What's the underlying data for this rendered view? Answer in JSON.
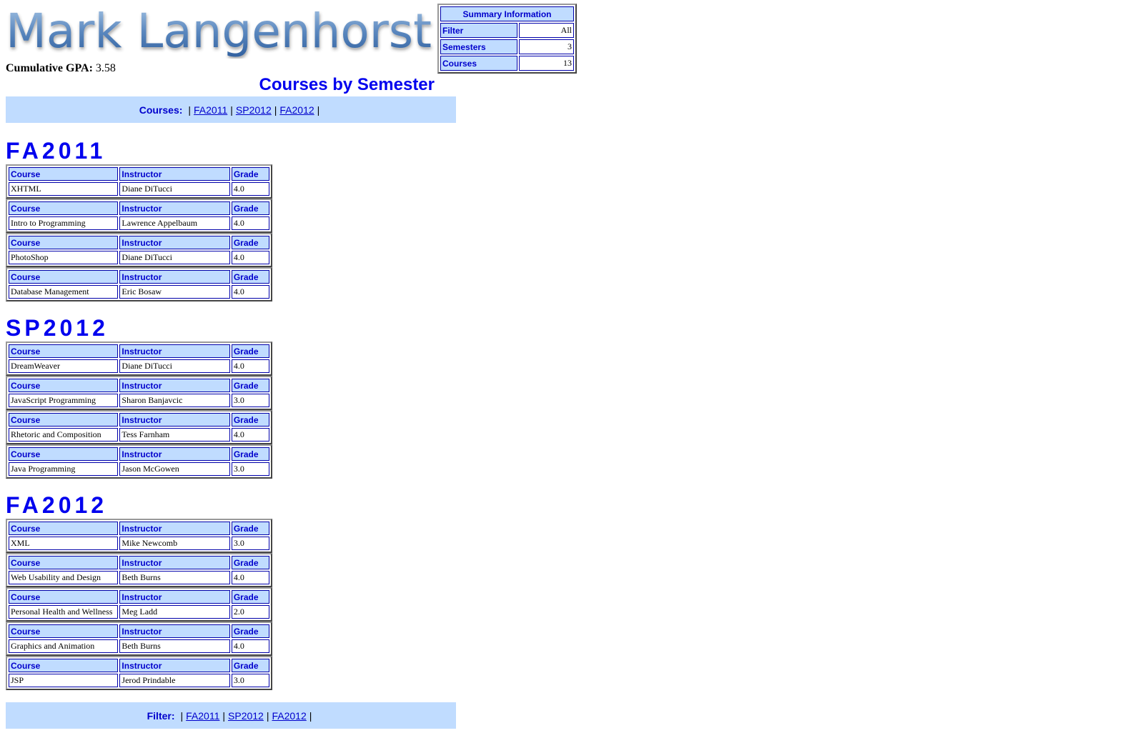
{
  "header": {
    "name": "Mark Langenhorst",
    "gpa_label": "Cumulative GPA:",
    "gpa_value": "3.58",
    "page_title": "Courses by Semester"
  },
  "summary": {
    "title": "Summary Information",
    "rows": [
      {
        "label": "Filter",
        "value": "All"
      },
      {
        "label": "Semesters",
        "value": "3"
      },
      {
        "label": "Courses",
        "value": "13"
      }
    ]
  },
  "top_nav": {
    "label": "Courses:",
    "links": [
      "FA2011",
      "SP2012",
      "FA2012"
    ]
  },
  "bottom_nav": {
    "label": "Filter:",
    "links": [
      "FA2011",
      "SP2012",
      "FA2012"
    ]
  },
  "column_headers": {
    "course": "Course",
    "instructor": "Instructor",
    "grade": "Grade"
  },
  "semesters": [
    {
      "name": "FA2011",
      "courses": [
        {
          "course": "XHTML",
          "instructor": "Diane DiTucci",
          "grade": "4.0"
        },
        {
          "course": "Intro to Programming",
          "instructor": "Lawrence Appelbaum",
          "grade": "4.0"
        },
        {
          "course": "PhotoShop",
          "instructor": "Diane DiTucci",
          "grade": "4.0"
        },
        {
          "course": "Database Management",
          "instructor": "Eric Bosaw",
          "grade": "4.0"
        }
      ]
    },
    {
      "name": "SP2012",
      "courses": [
        {
          "course": "DreamWeaver",
          "instructor": "Diane DiTucci",
          "grade": "4.0"
        },
        {
          "course": "JavaScript Programming",
          "instructor": "Sharon Banjavcic",
          "grade": "3.0"
        },
        {
          "course": "Rhetoric and Composition",
          "instructor": "Tess Farnham",
          "grade": "4.0"
        },
        {
          "course": "Java Programming",
          "instructor": "Jason McGowen",
          "grade": "3.0"
        }
      ]
    },
    {
      "name": "FA2012",
      "courses": [
        {
          "course": "XML",
          "instructor": "Mike Newcomb",
          "grade": "3.0"
        },
        {
          "course": "Web Usability and Design",
          "instructor": "Beth Burns",
          "grade": "4.0"
        },
        {
          "course": "Personal Health and Wellness",
          "instructor": "Meg Ladd",
          "grade": "2.0"
        },
        {
          "course": "Graphics and Animation",
          "instructor": "Beth Burns",
          "grade": "4.0"
        },
        {
          "course": "JSP",
          "instructor": "Jerod Prindable",
          "grade": "3.0"
        }
      ]
    }
  ],
  "colors": {
    "accent": "#0000ee",
    "header_bg": "#c0dcff",
    "border": "#0000aa"
  }
}
